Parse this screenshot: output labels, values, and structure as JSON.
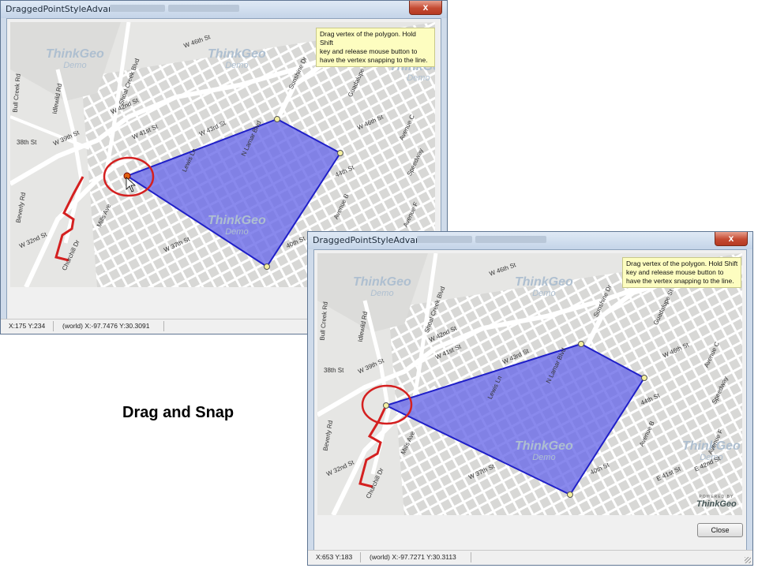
{
  "windows": [
    {
      "title": "DraggedPointStyleAdvanced",
      "close_glyph": "x",
      "tooltip": [
        "Drag vertex of the polygon. Hold Shift",
        "key and release mouse button to",
        "have the vertex snapping to the line."
      ],
      "watermarks": [
        {
          "brand": "ThinkGeo",
          "sub": "Demo"
        },
        {
          "brand": "ThinkGeo",
          "sub": "Demo"
        },
        {
          "brand": "ThinkGeo",
          "sub": "Demo"
        },
        {
          "brand": "ThinkGeo",
          "sub": "Demo"
        }
      ],
      "streets": [
        "W 46th St",
        "Shoal Creek Blvd",
        "Idlewild Rd",
        "Bull Creek Rd",
        "38th St",
        "W 39th St",
        "W 42nd St",
        "W 41st St",
        "W 43rd St",
        "Lewis Ln",
        "N Lamar Blvd",
        "Sunshine Dr",
        "Guadalupe St",
        "W 46th St",
        "44th St",
        "Avenue C",
        "Avenue B",
        "Speedway",
        "Avenue F",
        "40th St",
        "Beverly Rd",
        "W 32nd St",
        "Churchill Dr",
        "Mills Ave",
        "W 37th St"
      ],
      "status": {
        "xy": "X:175 Y:234",
        "world": "(world) X:-97.7476 Y:30.3091"
      }
    },
    {
      "title": "DraggedPointStyleAdvanced",
      "close_glyph": "x",
      "tooltip": [
        "Drag vertex of the polygon. Hold Shift",
        "key and release mouse button to",
        "have the vertex snapping to the line."
      ],
      "watermarks": [
        {
          "brand": "ThinkGeo",
          "sub": "Demo"
        },
        {
          "brand": "ThinkGeo",
          "sub": "Demo"
        },
        {
          "brand": "ThinkGeo",
          "sub": "Demo"
        },
        {
          "brand": "ThinkGeo",
          "sub": "Demo"
        }
      ],
      "streets": [
        "W 46th St",
        "Shoal Creek Blvd",
        "Idlewild Rd",
        "Bull Creek Rd",
        "38th St",
        "W 39th St",
        "W 42nd St",
        "W 41st St",
        "W 43rd St",
        "Lewis Ln",
        "N Lamar Blvd",
        "Sunshine Dr",
        "Guadalupe St",
        "W 46th St",
        "44th St",
        "Avenue C",
        "Avenue B",
        "Speedway",
        "Avenue F",
        "40th St",
        "E 41st St",
        "E 42nd St",
        "Beverly Rd",
        "W 32nd St",
        "Churchill Dr",
        "Mills Ave",
        "W 37th St"
      ],
      "powered": {
        "line1": "POWERED BY",
        "line2": "ThinkGeo"
      },
      "close_button": "Close",
      "status": {
        "xy": "X:653 Y:183",
        "world": "(world) X:-97.7271 Y:30.3113"
      }
    }
  ],
  "caption": "Drag and Snap",
  "colors": {
    "polygon_fill": "#6b6be8",
    "polygon_stroke": "#1f1fc8",
    "snap_line": "#d42020",
    "highlight_circle": "#d42020",
    "vertex": "#f5f0a0",
    "tooltip_bg": "#fdfdc0"
  }
}
